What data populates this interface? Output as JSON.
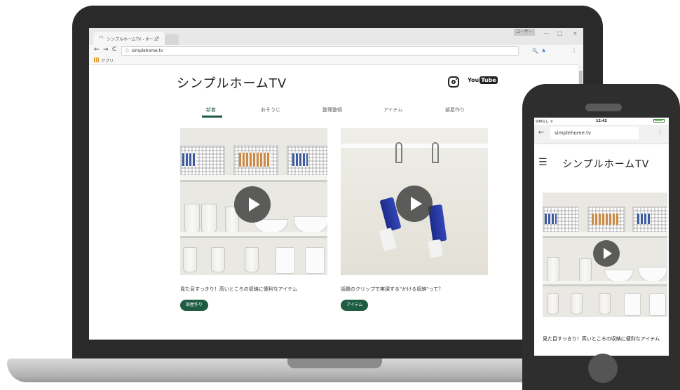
{
  "browser": {
    "tab_title": "シンプルホームTV - ホーム",
    "tab_favicon": "TV",
    "tab_close": "×",
    "user_badge": "ユーザー",
    "win_min": "—",
    "win_max": "□",
    "win_close": "×",
    "nav_back": "←",
    "nav_forward": "→",
    "nav_reload": "C",
    "info_icon": "ⓘ",
    "url": "simplehome.tv",
    "zoom_icon": "🔍",
    "star_icon": "★",
    "menu_icon": "⋮",
    "apps_label": "アプリ"
  },
  "site": {
    "title": "シンプルホームTV",
    "youtube_you": "You",
    "youtube_tube": "Tube",
    "nav": [
      {
        "label": "新着",
        "active": true
      },
      {
        "label": "おそうじ"
      },
      {
        "label": "整理整頓"
      },
      {
        "label": "アイテム"
      },
      {
        "label": "部屋作り"
      }
    ],
    "cards": [
      {
        "caption": "見た目すっきり！高いところの収納に便利なアイテム",
        "tag": "部屋作り"
      },
      {
        "caption": "話題のクリップで実現する\"かける収納\"って？",
        "tag": "アイテム"
      }
    ]
  },
  "phone": {
    "carrier": "SIMなし ᯤ",
    "time": "12:42",
    "back_icon": "←",
    "url": "simplehome.tv",
    "menu_icon": "⋮",
    "hamburger": "☰",
    "title": "シンプルホームTV",
    "caption": "見た目すっきり！高いところの収納に便利なアイテム"
  },
  "colors": {
    "accent": "#1e5c43",
    "device_frame": "#2a2a2a",
    "bookmark_star": "#3b78e7"
  }
}
